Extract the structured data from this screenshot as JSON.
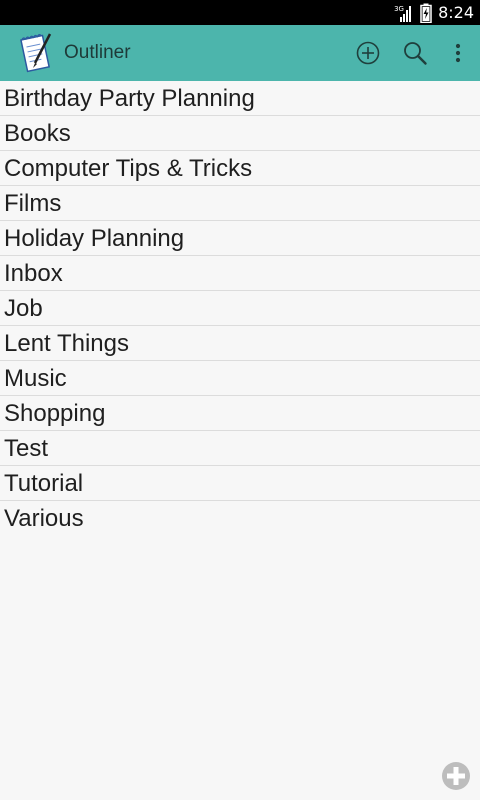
{
  "status_bar": {
    "network_type": "3G",
    "time": "8:24",
    "icons": [
      "signal-icon",
      "battery-icon"
    ]
  },
  "app_bar": {
    "title": "Outliner",
    "logo_icon": "notepad-pen-icon",
    "actions": [
      "add-circle-icon",
      "search-icon",
      "overflow-menu-icon"
    ],
    "color": "#4cb5ac"
  },
  "outlines": [
    {
      "label": "Birthday Party Planning"
    },
    {
      "label": "Books"
    },
    {
      "label": "Computer Tips & Tricks"
    },
    {
      "label": "Films"
    },
    {
      "label": "Holiday Planning"
    },
    {
      "label": "Inbox"
    },
    {
      "label": "Job"
    },
    {
      "label": "Lent Things"
    },
    {
      "label": "Music"
    },
    {
      "label": "Shopping"
    },
    {
      "label": "Test"
    },
    {
      "label": "Tutorial"
    },
    {
      "label": "Various"
    }
  ],
  "fab": {
    "icon": "plus-circle-icon"
  }
}
